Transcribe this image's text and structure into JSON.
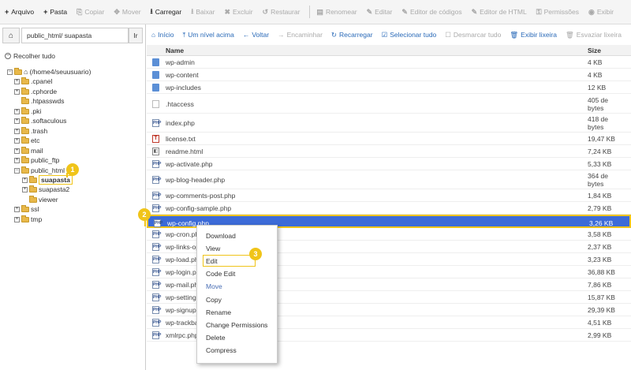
{
  "toolbar": {
    "buttons": [
      {
        "icon": "+",
        "label": "Arquivo",
        "enabled": true
      },
      {
        "icon": "+",
        "label": "Pasta",
        "enabled": true
      },
      {
        "icon": "⎘",
        "label": "Copiar",
        "enabled": false
      },
      {
        "icon": "✥",
        "label": "Mover",
        "enabled": false
      },
      {
        "icon": "⭳",
        "label": "Carregar",
        "enabled": true
      },
      {
        "icon": "⭳",
        "label": "Baixar",
        "enabled": false
      },
      {
        "icon": "✖",
        "label": "Excluir",
        "enabled": false
      },
      {
        "icon": "↺",
        "label": "Restaurar",
        "enabled": false
      },
      {
        "icon": "▤",
        "label": "Renomear",
        "enabled": false
      },
      {
        "icon": "✎",
        "label": "Editar",
        "enabled": false
      },
      {
        "icon": "✎",
        "label": "Editor de códigos",
        "enabled": false
      },
      {
        "icon": "✎",
        "label": "Editor de HTML",
        "enabled": false
      },
      {
        "icon": "⚿",
        "label": "Permissões",
        "enabled": false
      },
      {
        "icon": "◉",
        "label": "Exibir",
        "enabled": false
      }
    ]
  },
  "left_panel": {
    "path_value": "public_html/ suapasta",
    "go_label": "Ir",
    "collapse_label": "Recolher tudo",
    "tree": {
      "root": "(/home4/seuusuario)",
      "items": [
        {
          "label": ".cpanel",
          "plus": true
        },
        {
          "label": ".cphorde",
          "plus": true
        },
        {
          "label": ".htpasswds",
          "plus": false
        },
        {
          "label": ".pki",
          "plus": true
        },
        {
          "label": ".softaculous",
          "plus": true
        },
        {
          "label": ".trash",
          "plus": true
        },
        {
          "label": "etc",
          "plus": true
        },
        {
          "label": "mail",
          "plus": true
        },
        {
          "label": "public_ftp",
          "plus": true
        },
        {
          "label": "public_html",
          "plus": false,
          "open": true
        },
        {
          "label": "suapasta",
          "plus": true,
          "selected": true
        },
        {
          "label": "suapasta2",
          "plus": true
        },
        {
          "label": "viewer",
          "plus": false
        },
        {
          "label": "ssl",
          "plus": true
        },
        {
          "label": "tmp",
          "plus": true
        }
      ]
    }
  },
  "right_toolbar": {
    "buttons": [
      {
        "icon": "⌂",
        "label": "Início",
        "enabled": true
      },
      {
        "icon": "⤒",
        "label": "Um nível acima",
        "enabled": true
      },
      {
        "icon": "←",
        "label": "Voltar",
        "enabled": true
      },
      {
        "icon": "→",
        "label": "Encaminhar",
        "enabled": false
      },
      {
        "icon": "↻",
        "label": "Recarregar",
        "enabled": true
      },
      {
        "icon": "☑",
        "label": "Selecionar tudo",
        "enabled": true
      },
      {
        "icon": "☐",
        "label": "Desmarcar tudo",
        "enabled": false
      },
      {
        "icon": "🗑",
        "label": "Exibir lixeira",
        "enabled": true
      },
      {
        "icon": "🗑",
        "label": "Esvaziar lixeira",
        "enabled": false
      }
    ]
  },
  "table": {
    "col_name": "Name",
    "col_size": "Size",
    "rows": [
      {
        "name": "wp-admin",
        "size": "4 KB",
        "type": "folder"
      },
      {
        "name": "wp-content",
        "size": "4 KB",
        "type": "folder"
      },
      {
        "name": "wp-includes",
        "size": "12 KB",
        "type": "folder"
      },
      {
        "name": ".htaccess",
        "size": "405 de bytes",
        "type": "file"
      },
      {
        "name": "index.php",
        "size": "418 de bytes",
        "type": "php"
      },
      {
        "name": "license.txt",
        "size": "19,47 KB",
        "type": "txt"
      },
      {
        "name": "readme.html",
        "size": "7,24 KB",
        "type": "html"
      },
      {
        "name": "wp-activate.php",
        "size": "5,33 KB",
        "type": "php"
      },
      {
        "name": "wp-blog-header.php",
        "size": "364 de bytes",
        "type": "php"
      },
      {
        "name": "wp-comments-post.php",
        "size": "1,84 KB",
        "type": "php"
      },
      {
        "name": "wp-config-sample.php",
        "size": "2,79 KB",
        "type": "php"
      },
      {
        "name": "wp-config.php",
        "size": "3,26 KB",
        "type": "php",
        "selected": true
      },
      {
        "name": "wp-cron.php",
        "size": "3,58 KB",
        "type": "php"
      },
      {
        "name": "wp-links-opml.php",
        "size": "2,37 KB",
        "type": "php"
      },
      {
        "name": "wp-load.php",
        "size": "3,23 KB",
        "type": "php"
      },
      {
        "name": "wp-login.php",
        "size": "36,88 KB",
        "type": "php"
      },
      {
        "name": "wp-mail.php",
        "size": "7,86 KB",
        "type": "php"
      },
      {
        "name": "wp-settings.php",
        "size": "15,87 KB",
        "type": "php"
      },
      {
        "name": "wp-signup.php",
        "size": "29,39 KB",
        "type": "php"
      },
      {
        "name": "wp-trackback.php",
        "size": "4,51 KB",
        "type": "php"
      },
      {
        "name": "xmlrpc.php",
        "size": "2,99 KB",
        "type": "php"
      }
    ]
  },
  "context_menu": {
    "items": [
      {
        "label": "Download",
        "enabled": true
      },
      {
        "label": "View",
        "enabled": true
      },
      {
        "label": "Edit",
        "enabled": true
      },
      {
        "label": "Code Edit",
        "enabled": true
      },
      {
        "label": "Move",
        "enabled": false
      },
      {
        "label": "Copy",
        "enabled": true
      },
      {
        "label": "Rename",
        "enabled": true
      },
      {
        "label": "Change Permissions",
        "enabled": true
      },
      {
        "label": "Delete",
        "enabled": true
      },
      {
        "label": "Compress",
        "enabled": true
      }
    ]
  },
  "callouts": [
    "1",
    "2",
    "3"
  ],
  "colors": {
    "accent": "#f0c419",
    "selection": "#3c6bd8",
    "link": "#2a6ab8"
  }
}
